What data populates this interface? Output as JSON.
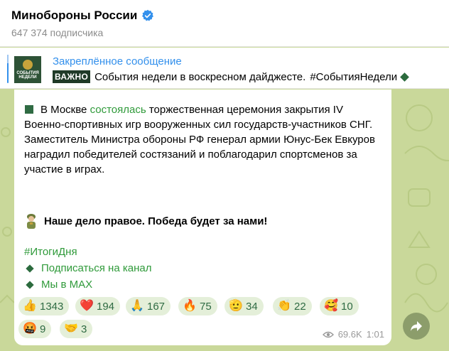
{
  "header": {
    "channel_title": "Минобороны России",
    "subscribers": "647 374 подписчика"
  },
  "pinned": {
    "label": "Закреплённое сообщение",
    "thumb_text_1": "СОБЫТИЯ",
    "thumb_text_2": "НЕДЕЛИ",
    "badge": "ВАЖНО",
    "text": "События недели в воскресном дайджесте.",
    "hashtag": "#СобытияНедели"
  },
  "message": {
    "para_prefix": "В Москве ",
    "para_link": "состоялась",
    "para_rest": " торжественная церемония закрытия IV Военно-спортивных игр вооруженных сил государств-участников СНГ. Заместитель Министра обороны РФ генерал армии Юнус-Бек Евкуров наградил победителей состязаний и поблагодарил спортсменов за участие в играх.",
    "motto": "Наше дело правое. Победа будет за нами!",
    "hashtag": "#ИтогиДня",
    "links": [
      "Подписаться на канал",
      "Мы в MAX"
    ],
    "reactions": [
      {
        "emoji": "👍",
        "count": "1343"
      },
      {
        "emoji": "❤️",
        "count": "194"
      },
      {
        "emoji": "🙏",
        "count": "167"
      },
      {
        "emoji": "🔥",
        "count": "75"
      },
      {
        "emoji": "🫡",
        "count": "34"
      },
      {
        "emoji": "👏",
        "count": "22"
      },
      {
        "emoji": "🥰",
        "count": "10"
      },
      {
        "emoji": "🤬",
        "count": "9"
      },
      {
        "emoji": "🤝",
        "count": "3"
      }
    ],
    "views": "69.6K",
    "time": "1:01"
  },
  "colors": {
    "accent": "#3390ec",
    "link_green": "#2f9a3a",
    "reaction_bg": "#e4efd9",
    "chat_bg": "#c9d89a"
  }
}
